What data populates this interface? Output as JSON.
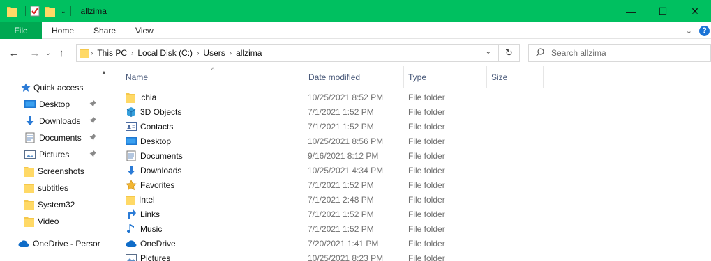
{
  "window": {
    "title": "allzima",
    "minimize_glyph": "—",
    "maximize_glyph": "☐",
    "close_glyph": "✕",
    "accent": "#00c060"
  },
  "ribbon": {
    "tabs": [
      "File",
      "Home",
      "Share",
      "View"
    ],
    "expand_glyph": "⌄",
    "help_glyph": "?"
  },
  "nav": {
    "back_glyph": "←",
    "forward_glyph": "→",
    "recent_glyph": "⌄",
    "up_glyph": "↑",
    "breadcrumb": [
      "This PC",
      "Local Disk (C:)",
      "Users",
      "allzima"
    ],
    "separator_glyph": "›",
    "dropdown_glyph": "⌄",
    "refresh_glyph": "↻",
    "search_glyph": "⚲",
    "search_placeholder": "Search allzima"
  },
  "sidebar": {
    "scroll_up_glyph": "▲",
    "quick_access": "Quick access",
    "items": [
      {
        "label": "Desktop",
        "icon": "desktop-icon",
        "pinned": true
      },
      {
        "label": "Downloads",
        "icon": "downloads-icon",
        "pinned": true
      },
      {
        "label": "Documents",
        "icon": "documents-icon",
        "pinned": true
      },
      {
        "label": "Pictures",
        "icon": "pictures-icon",
        "pinned": true
      },
      {
        "label": "Screenshots",
        "icon": "folder-icon",
        "pinned": false
      },
      {
        "label": "subtitles",
        "icon": "folder-icon",
        "pinned": false
      },
      {
        "label": "System32",
        "icon": "folder-icon",
        "pinned": false
      },
      {
        "label": "Video",
        "icon": "folder-icon",
        "pinned": false
      }
    ],
    "pin_glyph": "📌",
    "onedrive": "OneDrive - Persor"
  },
  "columns": {
    "name": "Name",
    "date": "Date modified",
    "type": "Type",
    "size": "Size",
    "sort_glyph": "^"
  },
  "files": [
    {
      "name": ".chia",
      "icon": "folder-icon",
      "date": "10/25/2021 8:52 PM",
      "type": "File folder"
    },
    {
      "name": "3D Objects",
      "icon": "3d-objects-icon",
      "date": "7/1/2021 1:52 PM",
      "type": "File folder"
    },
    {
      "name": "Contacts",
      "icon": "contacts-icon",
      "date": "7/1/2021 1:52 PM",
      "type": "File folder"
    },
    {
      "name": "Desktop",
      "icon": "desktop-icon",
      "date": "10/25/2021 8:56 PM",
      "type": "File folder"
    },
    {
      "name": "Documents",
      "icon": "documents-icon",
      "date": "9/16/2021 8:12 PM",
      "type": "File folder"
    },
    {
      "name": "Downloads",
      "icon": "downloads-icon",
      "date": "10/25/2021 4:34 PM",
      "type": "File folder"
    },
    {
      "name": "Favorites",
      "icon": "favorites-star-icon",
      "date": "7/1/2021 1:52 PM",
      "type": "File folder"
    },
    {
      "name": "Intel",
      "icon": "folder-icon",
      "date": "7/1/2021 2:48 PM",
      "type": "File folder"
    },
    {
      "name": "Links",
      "icon": "links-arrow-icon",
      "date": "7/1/2021 1:52 PM",
      "type": "File folder"
    },
    {
      "name": "Music",
      "icon": "music-note-icon",
      "date": "7/1/2021 1:52 PM",
      "type": "File folder"
    },
    {
      "name": "OneDrive",
      "icon": "onedrive-cloud-icon",
      "date": "7/20/2021 1:41 PM",
      "type": "File folder"
    },
    {
      "name": "Pictures",
      "icon": "pictures-icon",
      "date": "10/25/2021 8:23 PM",
      "type": "File folder"
    }
  ]
}
